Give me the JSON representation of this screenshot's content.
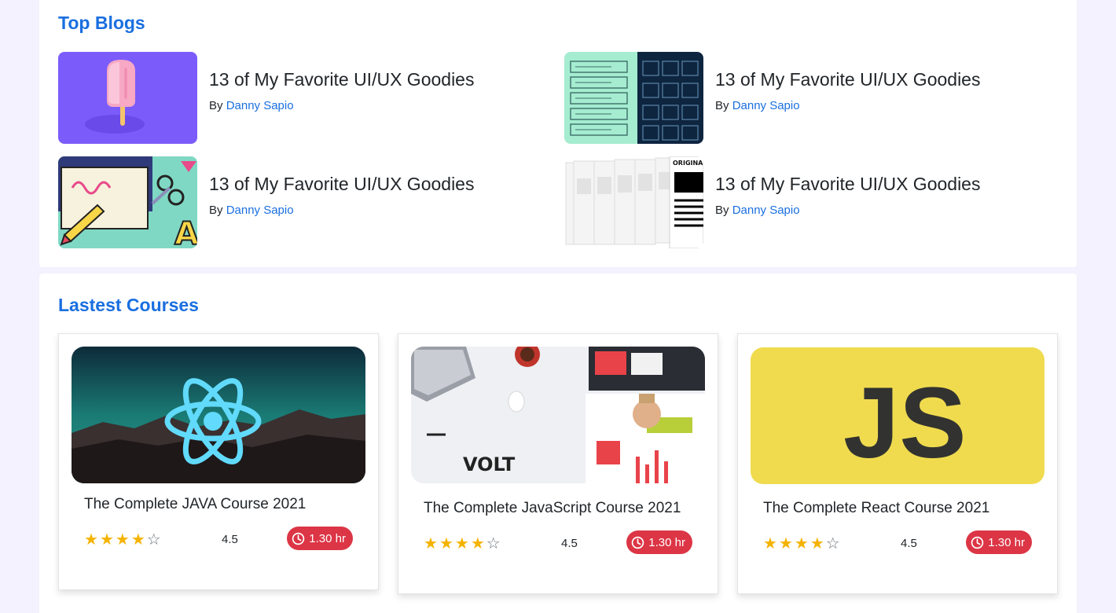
{
  "top_blogs": {
    "title": "Top Blogs",
    "items": [
      {
        "title": "13 of My Favorite UI/UX Goodies",
        "by": "By",
        "author": "Danny Sapio",
        "thumb_icon": "popsicle-illustration"
      },
      {
        "title": "13 of My Favorite UI/UX Goodies",
        "by": "By",
        "author": "Danny Sapio",
        "thumb_icon": "wireframe-grid-illustration"
      },
      {
        "title": "13 of My Favorite UI/UX Goodies",
        "by": "By",
        "author": "Danny Sapio",
        "thumb_icon": "design-tools-illustration"
      },
      {
        "title": "13 of My Favorite UI/UX Goodies",
        "by": "By",
        "author": "Danny Sapio",
        "thumb_icon": "document-pages-illustration"
      }
    ]
  },
  "latest_courses": {
    "title": "Lastest Courses",
    "items": [
      {
        "title": "The Complete JAVA Course 2021",
        "rating": "4.5",
        "stars": 4,
        "max_stars": 5,
        "duration": "1.30 hr",
        "image": "react-logo-mountains"
      },
      {
        "title": "The Complete JavaScript Course 2021",
        "rating": "4.5",
        "stars": 4,
        "max_stars": 5,
        "duration": "1.30 hr",
        "image": "volt-desk-mockup",
        "image_text": "VOLT"
      },
      {
        "title": "The Complete React Course 2021",
        "rating": "4.5",
        "stars": 4,
        "max_stars": 5,
        "duration": "1.30 hr",
        "image": "javascript-logo",
        "image_text": "JS"
      }
    ]
  },
  "colors": {
    "page_bg": "#f3f2fe",
    "heading": "#1a6fe0",
    "link": "#1a6fe0",
    "star": "#f5b301",
    "badge": "#dc3545"
  }
}
